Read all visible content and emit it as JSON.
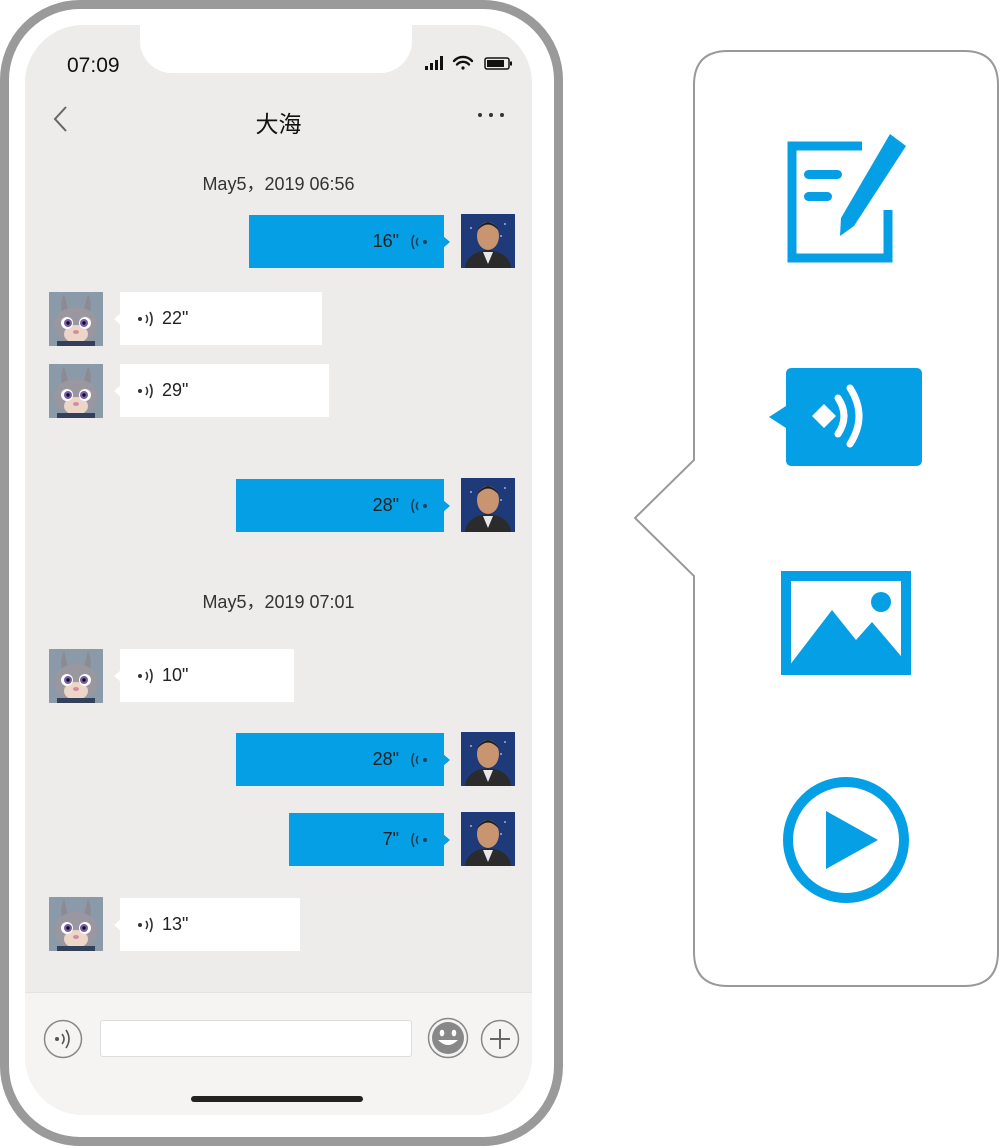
{
  "status_bar": {
    "time": "07:09"
  },
  "header": {
    "title": "大海"
  },
  "colors": {
    "accent": "#049fe4",
    "chat_bg": "#edecea",
    "phone_frame": "#9a9a9a",
    "incoming_bubble": "#ffffff"
  },
  "avatars": {
    "me": "man-portrait-avatar",
    "contact": "cartoon-bunny-avatar"
  },
  "timestamps": [
    "May5，2019 06:56",
    "May5，2019 07:01"
  ],
  "messages": [
    {
      "direction": "out",
      "duration": "16\""
    },
    {
      "direction": "in",
      "duration": "22\""
    },
    {
      "direction": "in",
      "duration": "29\""
    },
    {
      "direction": "out",
      "duration": "28\""
    },
    {
      "direction": "in",
      "duration": "10\""
    },
    {
      "direction": "out",
      "duration": "28\""
    },
    {
      "direction": "out",
      "duration": "7\""
    },
    {
      "direction": "in",
      "duration": "13\""
    }
  ],
  "input_bar": {
    "placeholder": ""
  },
  "message_type_panel": {
    "items": [
      "edit-text-icon",
      "voice-message-icon",
      "image-icon",
      "video-play-icon"
    ]
  }
}
